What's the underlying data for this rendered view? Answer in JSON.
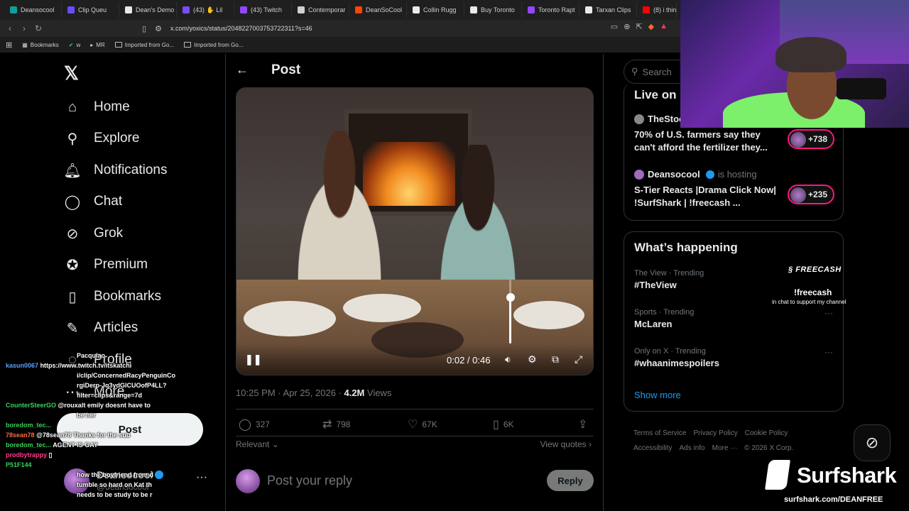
{
  "browser": {
    "tabs": [
      {
        "label": "Deansocool",
        "color": "#0e9f9a"
      },
      {
        "label": "Clip Queu",
        "color": "#6a4cff"
      },
      {
        "label": "Dean's Demo",
        "color": "#e7e9ea"
      },
      {
        "label": "(43) ✋ Lil",
        "color": "#7a4cff"
      },
      {
        "label": "(43) Twitch",
        "color": "#9146ff"
      },
      {
        "label": "Contemporar",
        "color": "#d0d0d0"
      },
      {
        "label": "DeanSoCool",
        "color": "#ff4500"
      },
      {
        "label": "Collin Rugg",
        "color": "#e7e9ea"
      },
      {
        "label": "Buy Toronto",
        "color": "#e7e9ea"
      },
      {
        "label": "Toronto Rapt",
        "color": "#9146ff"
      },
      {
        "label": "Tarxan Clips",
        "color": "#e7e9ea"
      },
      {
        "label": "(8) i think i",
        "color": "#ff0000"
      }
    ],
    "url": "x.com/yoxics/status/2048227003753722311?s=46",
    "bookmarks": [
      "Bookmarks",
      "w",
      "MR",
      "Imported from Go...",
      "Imported from Go..."
    ]
  },
  "nav": {
    "items": [
      {
        "label": "Home",
        "icon": "home-icon",
        "glyph": "⌂"
      },
      {
        "label": "Explore",
        "icon": "search-icon",
        "glyph": "⚲"
      },
      {
        "label": "Notifications",
        "icon": "bell-icon",
        "glyph": "🔔︎"
      },
      {
        "label": "Chat",
        "icon": "chat-bubble-icon",
        "glyph": "◯"
      },
      {
        "label": "Grok",
        "icon": "grok-icon",
        "glyph": "⊘"
      },
      {
        "label": "Premium",
        "icon": "verified-icon",
        "glyph": "✪"
      },
      {
        "label": "Bookmarks",
        "icon": "bookmark-icon",
        "glyph": "▯"
      },
      {
        "label": "Articles",
        "icon": "article-icon",
        "glyph": "✎"
      },
      {
        "label": "Profile",
        "icon": "profile-icon",
        "glyph": "◌"
      },
      {
        "label": "More",
        "icon": "more-icon",
        "glyph": "⋯"
      }
    ],
    "post_button": "Post",
    "account": {
      "name": "Deansocool",
      "handle": "@deansocool"
    }
  },
  "chat": [
    {
      "user": "",
      "text": "Pacquiao",
      "color": "#ffffff"
    },
    {
      "user": "kasun0067",
      "text": "https://www.twitch.tv/itskatchi",
      "color": "#5aa0ff"
    },
    {
      "user": "",
      "text": "i/clip/ConcernedRacyPenguinCo",
      "color": "#ffffff"
    },
    {
      "user": "",
      "text": "rgiDerp-Jq3ydGlCUOofP4LL?",
      "color": "#ffffff"
    },
    {
      "user": "",
      "text": "filter=clips&range=7d",
      "color": "#ffffff"
    },
    {
      "user": "CounterSteerGO",
      "text": "@rouxalt emily doesnt have to",
      "color": "#3ad15a"
    },
    {
      "user": "",
      "text": "be her",
      "color": "#ffffff"
    },
    {
      "user": "boredom_tec...",
      "text": "",
      "color": "#3ad15a"
    },
    {
      "user": "78sean78",
      "text": "@78sean78 Thanks for the sub",
      "color": "#ff6a3a"
    },
    {
      "user": "boredom_tec...",
      "text": "AGENT IS GAY",
      "color": "#3ad15a"
    },
    {
      "user": "prodbytrappy",
      "text": "▯",
      "color": "#ff3a8a"
    },
    {
      "user": "P51F144",
      "text": "",
      "color": "#3ad15a"
    },
    {
      "user": "",
      "text": "how the boyfriend from d",
      "color": "#ffffff"
    },
    {
      "user": "",
      "text": "tumble so hard on Kat th",
      "color": "#ffffff"
    },
    {
      "user": "",
      "text": "needs to be study to be r",
      "color": "#ffffff"
    }
  ],
  "post": {
    "header": "Post",
    "video": {
      "current_time": "0:02",
      "duration": "0:46",
      "volume": 0.72,
      "playing": true
    },
    "time": "10:25 PM · Apr 25, 2026 · ",
    "views_count": "4.2M",
    "views_label": " Views",
    "stats": {
      "replies": "327",
      "reposts": "798",
      "likes": "67K",
      "bookmarks": "6K"
    },
    "sort_label": "Relevant",
    "view_quotes": "View quotes",
    "reply_placeholder": "Post your reply",
    "reply_button": "Reply"
  },
  "right": {
    "search_placeholder": "Search",
    "live_title": "Live on",
    "live": [
      {
        "host": "TheStoc",
        "sub": "",
        "desc": "70% of U.S. farmers say they can't afford the fertilizer they...",
        "count": "+738"
      },
      {
        "host": "Deansocool",
        "sub": "is hosting",
        "desc": "S-Tier Reacts |Drama Click Now| !SurfShark | !freecash ...",
        "count": "+235"
      }
    ],
    "happening_title": "What’s happening",
    "trends": [
      {
        "context": "The View · Trending",
        "name": "#TheView"
      },
      {
        "context": "Sports · Trending",
        "name": "McLaren"
      },
      {
        "context": "Only on X · Trending",
        "name": "#whaanimespoilers"
      }
    ],
    "show_more": "Show more",
    "footer": [
      "Terms of Service",
      "Privacy Policy",
      "Cookie Policy",
      "Accessibility",
      "Ads info",
      "More ···",
      "© 2026 X Corp."
    ]
  },
  "overlays": {
    "freecash_logo": "FREECASH",
    "freecash_name": "!freecash",
    "freecash_sub": "in chat to support my channel",
    "surfshark_word": "Surfshark",
    "surfshark_url": "surfshark.com/DEANFREE"
  }
}
